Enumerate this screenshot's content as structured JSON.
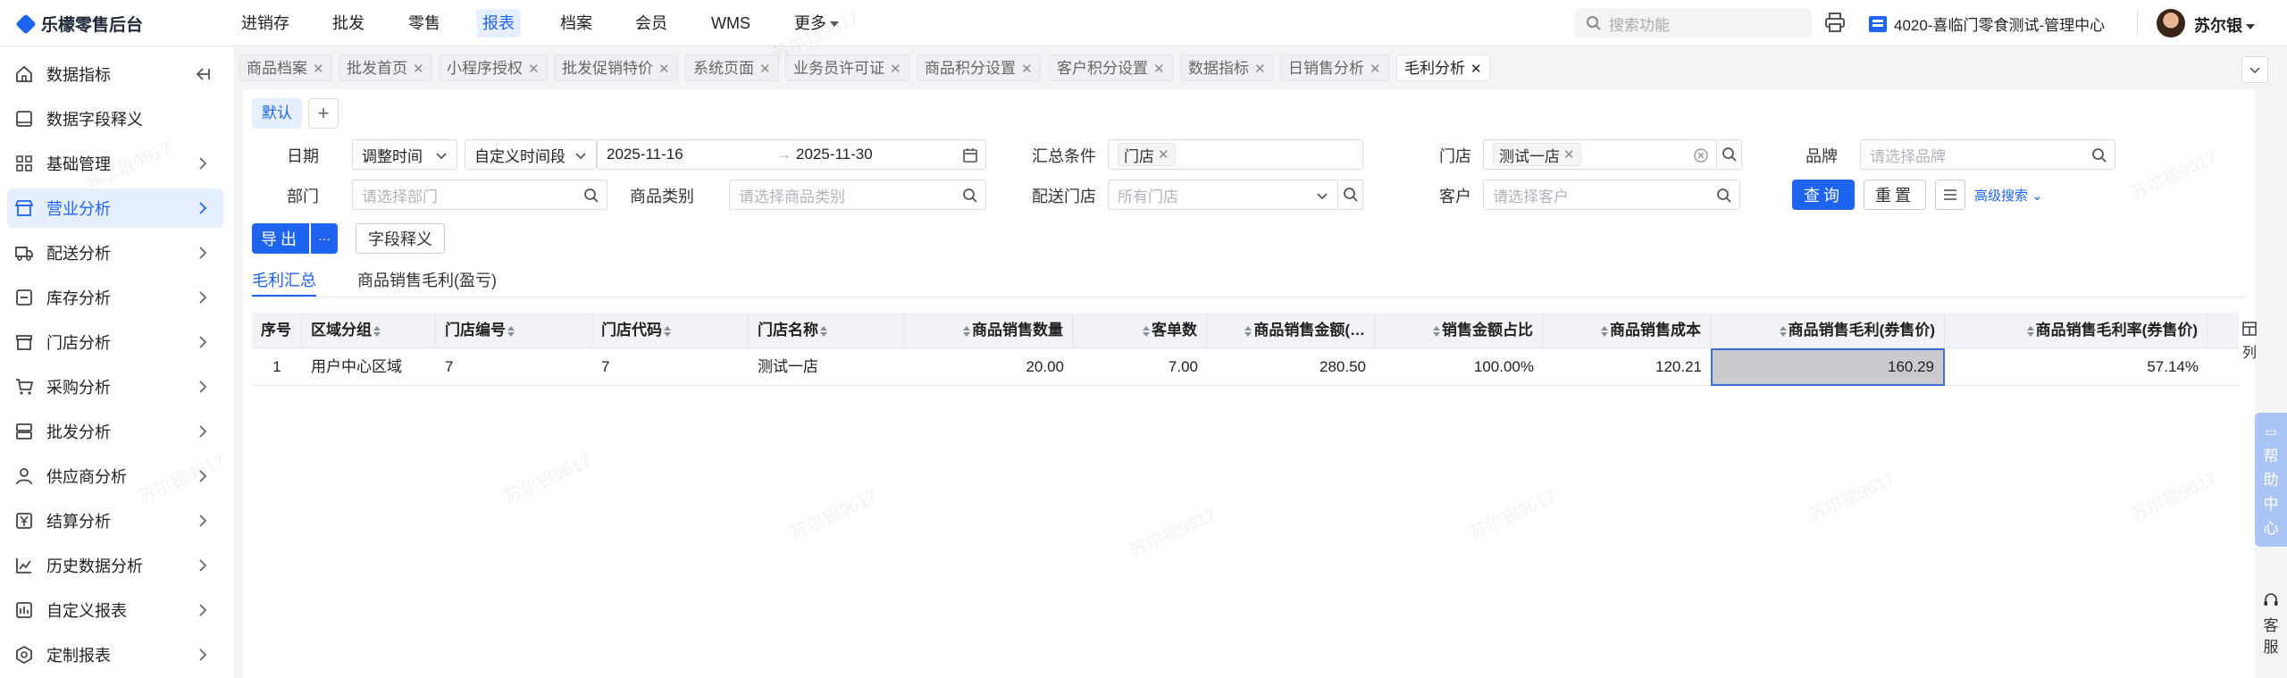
{
  "app": {
    "title": "乐檬零售后台"
  },
  "topnav": {
    "items": [
      "进销存",
      "批发",
      "零售",
      "报表",
      "档案",
      "会员",
      "WMS",
      "更多"
    ],
    "active_index": 3,
    "search_placeholder": "搜索功能",
    "store": "4020-喜临门零食测试-管理中心",
    "user": "苏尔银"
  },
  "sidebar": {
    "items": [
      {
        "label": "数据指标",
        "icon": "home-icon"
      },
      {
        "label": "数据字段释义",
        "icon": "book-icon"
      },
      {
        "label": "基础管理",
        "icon": "grid-icon"
      },
      {
        "label": "营业分析",
        "icon": "store-icon"
      },
      {
        "label": "配送分析",
        "icon": "truck-icon"
      },
      {
        "label": "库存分析",
        "icon": "inventory-icon"
      },
      {
        "label": "门店分析",
        "icon": "shop-icon"
      },
      {
        "label": "采购分析",
        "icon": "cart-icon"
      },
      {
        "label": "批发分析",
        "icon": "wholesale-icon"
      },
      {
        "label": "供应商分析",
        "icon": "supplier-icon"
      },
      {
        "label": "结算分析",
        "icon": "yen-icon"
      },
      {
        "label": "历史数据分析",
        "icon": "chart-icon"
      },
      {
        "label": "自定义报表",
        "icon": "custom-report-icon"
      },
      {
        "label": "定制报表",
        "icon": "hex-icon"
      }
    ],
    "active_index": 3
  },
  "tabs": {
    "items": [
      "商品档案",
      "批发首页",
      "小程序授权",
      "批发促销特价",
      "系统页面",
      "业务员许可证",
      "商品积分设置",
      "客户积分设置",
      "数据指标",
      "日销售分析",
      "毛利分析"
    ],
    "active_index": 10
  },
  "filters": {
    "default_chip": "默认",
    "add_chip": "+",
    "date_label": "日期",
    "date_type": "调整时间",
    "date_range_type": "自定义时间段",
    "date_from": "2025-11-16",
    "date_arrow": "→",
    "date_to": "2025-11-30",
    "summary_label": "汇总条件",
    "summary_tag": "门店",
    "store_label": "门店",
    "store_tag": "测试一店",
    "brand_label": "品牌",
    "brand_placeholder": "请选择品牌",
    "dept_label": "部门",
    "dept_placeholder": "请选择部门",
    "category_label": "商品类别",
    "category_placeholder": "请选择商品类别",
    "delivery_label": "配送门店",
    "delivery_placeholder": "所有门店",
    "customer_label": "客户",
    "customer_placeholder": "请选择客户",
    "query_button": "查询",
    "reset_button": "重置",
    "advanced_link": "高级搜索"
  },
  "actions": {
    "export": "导出",
    "more": "···",
    "field_desc": "字段释义"
  },
  "subtabs": [
    "毛利汇总",
    "商品销售毛利(盈亏)"
  ],
  "table": {
    "headers": [
      "序号",
      "区域分组",
      "门店编号",
      "门店代码",
      "门店名称",
      "商品销售数量",
      "客单数",
      "商品销售金额(…",
      "销售金额占比",
      "商品销售成本",
      "商品销售毛利(券售价)",
      "商品销售毛利率(券售价)"
    ],
    "rows": [
      [
        "1",
        "用户中心区域",
        "7",
        "7",
        "测试一店",
        "20.00",
        "7.00",
        "280.50",
        "100.00%",
        "120.21",
        "160.29",
        "57.14%"
      ]
    ]
  },
  "right_panel": {
    "columns_label": "列",
    "help_label": "帮助中心",
    "service_label": "客服"
  },
  "watermark": "苏尔银9617",
  "colors": {
    "accent": "#1e64f0",
    "active_bg": "#e6efff"
  }
}
